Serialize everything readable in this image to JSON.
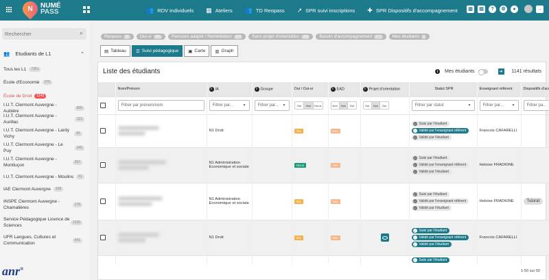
{
  "app": {
    "logo_line1": "NUMÉ",
    "logo_line2": "PASS",
    "logo_letter": "N"
  },
  "nav": [
    {
      "label": "RDV individuels",
      "icon": "people-icon"
    },
    {
      "label": "Ateliers",
      "icon": "calendar-icon"
    },
    {
      "label": "TD Reopass",
      "icon": "group-icon"
    },
    {
      "label": "SPR suivi inscriptions",
      "icon": "trend-icon"
    },
    {
      "label": "SPR Dispositifs d'accompagnement",
      "icon": "puzzle-icon"
    }
  ],
  "sidebar": {
    "search_placeholder": "Rechercher",
    "students_label": "Etudiants de L1",
    "items": [
      {
        "label": "Tous les L1",
        "count": "7351"
      },
      {
        "label": "École d'Economie",
        "count": "275"
      },
      {
        "label": "École de Droit",
        "count": "1143"
      },
      {
        "label": "I.U.T. Clermont Auvergne - Aubière",
        "count": "906"
      },
      {
        "label": "I.U.T. Clermont Auvergne - Aurillac",
        "count": "112"
      },
      {
        "label": "I.U.T. Clermont Auvergne - Lardy Vichy",
        "count": "81"
      },
      {
        "label": "I.U.T. Clermont Auvergne - Le Puy",
        "count": "145"
      },
      {
        "label": "I.U.T. Clermont Auvergne - Montluçon",
        "count": "257"
      },
      {
        "label": "I.U.T. Clermont Auvergne - Moulins",
        "count": "61"
      },
      {
        "label": "IAE Clermont Auvergne",
        "count": "338"
      },
      {
        "label": "INSPE Clermont Auvergne - Chamalières",
        "count": "178"
      },
      {
        "label": "Service Pédagogique Licence de Sciences",
        "count": "1135"
      },
      {
        "label": "UFR Langues, Cultures et Communication",
        "count": "641"
      }
    ],
    "footer_logo": "anr"
  },
  "filters": [
    {
      "label": "Reopass",
      "count": "35"
    },
    {
      "label": "Oui-si",
      "count": "285"
    },
    {
      "label": "Parcours adapté / Remédiation",
      "count": "320"
    },
    {
      "label": "Sans projet d'orientation",
      "count": "289"
    },
    {
      "label": "Besoin d'accompagnement",
      "count": "272"
    },
    {
      "label": "Mes étudiants",
      "count": "0"
    }
  ],
  "views": [
    {
      "label": "Tableau",
      "active": false
    },
    {
      "label": "Suivi pédagogique",
      "active": true
    },
    {
      "label": "Carte",
      "active": false
    },
    {
      "label": "Graph",
      "active": false
    }
  ],
  "panel": {
    "title": "Liste des étudiants",
    "mine_label": "Mes étudiants",
    "results": "1141 résultats",
    "pager": "1-50 sur 50"
  },
  "table": {
    "headers": [
      "Nom/Prénom",
      "IA",
      "Groupe",
      "Oui / Oui-si",
      "EAD",
      "Projet d'orientation",
      "Statut SPR",
      "Enseignant référent",
      "Dispositifs d'accomp."
    ],
    "filter_placeholders": {
      "name": "Filtrer par prénom/nom",
      "ia": "Filtrer par...",
      "group": "Filtrer par...",
      "spr": "Filtrer par statut",
      "teacher": "Filtrer par...",
      "disp": "Filtrer pa..."
    },
    "seg_oui": [
      "Oui",
      "Non",
      "Oui-si"
    ],
    "seg_ead": [
      "Non",
      "Non",
      "Oui"
    ],
    "seg_proj": [
      "Oui",
      "Non",
      "Oui"
    ],
    "rows": [
      {
        "ia": "N1 Droit",
        "oui": "Oui",
        "oui_color": "or",
        "ead": "Non",
        "spr": [
          [
            "g",
            "Saisi par l'étudiant"
          ],
          [
            "t",
            "Validé par l'enseignant référent"
          ],
          [
            "g",
            "Validé par l'étudiant"
          ]
        ],
        "teacher": "Francois CAFARELLI",
        "disp": "",
        "eye": false
      },
      {
        "ia": "N1 Administration Economique et sociale",
        "oui": "Oui-si",
        "oui_color": "green",
        "ead": "Non",
        "spr": [
          [
            "g",
            "Saisi par l'étudiant"
          ],
          [
            "g",
            "Validé par l'enseignant référent"
          ],
          [
            "g",
            "Validé par l'étudiant"
          ]
        ],
        "teacher": "Heloise FRADKINE",
        "disp": "",
        "eye": false
      },
      {
        "ia": "N1 Administration Economique et sociale",
        "oui": "Oui",
        "oui_color": "or",
        "ead": "Non",
        "spr": [
          [
            "g",
            "Saisi par l'étudiant"
          ],
          [
            "g",
            "Validé par l'enseignant référent"
          ],
          [
            "g",
            "Validé par l'étudiant"
          ]
        ],
        "teacher": "Heloise FRADKINE",
        "disp": "Tutorat",
        "eye": false
      },
      {
        "ia": "N1 Droit",
        "oui": "Oui",
        "oui_color": "or",
        "ead": "Non",
        "spr": [
          [
            "t",
            "Saisi par l'étudiant"
          ],
          [
            "t",
            "Validé par l'enseignant référent"
          ],
          [
            "t",
            "Validé par l'étudiant"
          ]
        ],
        "teacher": "Francois CAFARELLI",
        "disp": "",
        "eye": true
      }
    ],
    "partial_row_spr": "Saisi par l'étudiant"
  }
}
